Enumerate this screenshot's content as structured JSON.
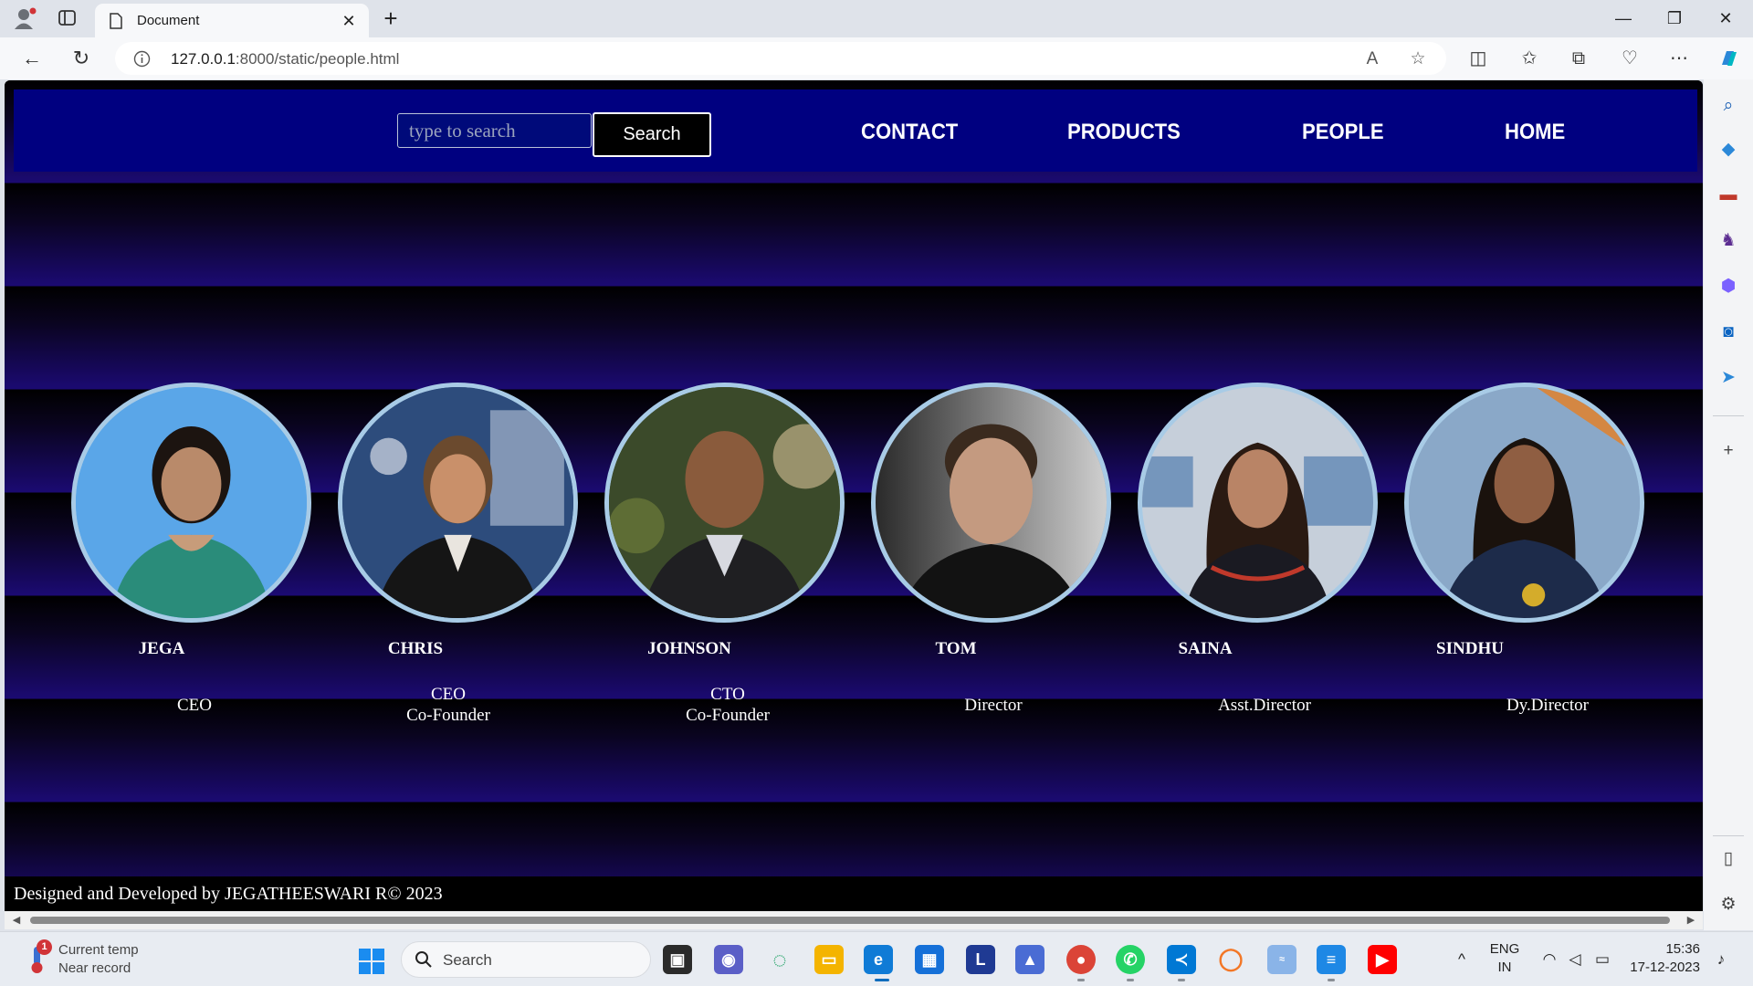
{
  "browser": {
    "tab_title": "Document",
    "url_host": "127.0.0.1",
    "url_rest": ":8000/static/people.html",
    "new_tab_glyph": "+",
    "close_glyph": "✕"
  },
  "navbar": {
    "search_placeholder": "type to search",
    "search_button": "Search",
    "links": [
      "CONTACT",
      "PRODUCTS",
      "PEOPLE",
      "HOME"
    ]
  },
  "people": [
    {
      "name": "JEGA",
      "role_lines": [
        "CEO"
      ]
    },
    {
      "name": "CHRIS",
      "role_lines": [
        "CEO",
        "Co-Founder"
      ]
    },
    {
      "name": "JOHNSON",
      "role_lines": [
        "CTO",
        "Co-Founder"
      ]
    },
    {
      "name": "TOM",
      "role_lines": [
        "Director"
      ]
    },
    {
      "name": "SAINA",
      "role_lines": [
        "Asst.Director"
      ]
    },
    {
      "name": "SINDHU",
      "role_lines": [
        "Dy.Director"
      ]
    }
  ],
  "footer": {
    "text": "Designed and Developed by JEGATHEESWARI R© 2023"
  },
  "taskbar": {
    "weather_badge": "1",
    "weather_line1": "Current temp",
    "weather_line2": "Near record",
    "search_label": "Search",
    "lang": "ENG",
    "region": "IN",
    "time": "15:36",
    "date": "17-12-2023",
    "l_app_letter": "L"
  },
  "colors": {
    "navbar_bg": "#000080",
    "band_dark": "#000000",
    "band_light": "#1b0a72",
    "photo_ring": "#a8cbe6"
  },
  "icons": {
    "side_panel": [
      "search-icon",
      "tag-icon",
      "toolbox-icon",
      "chess-icon",
      "copilot-icon",
      "outlook-icon",
      "send-icon",
      "add-icon",
      "sidebar-icon",
      "settings-icon"
    ],
    "taskbar_apps": [
      "task-view-icon",
      "chat-icon",
      "circle-app-icon",
      "file-explorer-icon",
      "edge-icon",
      "store-icon",
      "l-app-icon",
      "prisma-icon",
      "chrome-icon",
      "whatsapp-icon",
      "vscode-icon",
      "jupyter-icon",
      "camu-icon",
      "notepad-icon",
      "youtube-icon"
    ]
  }
}
